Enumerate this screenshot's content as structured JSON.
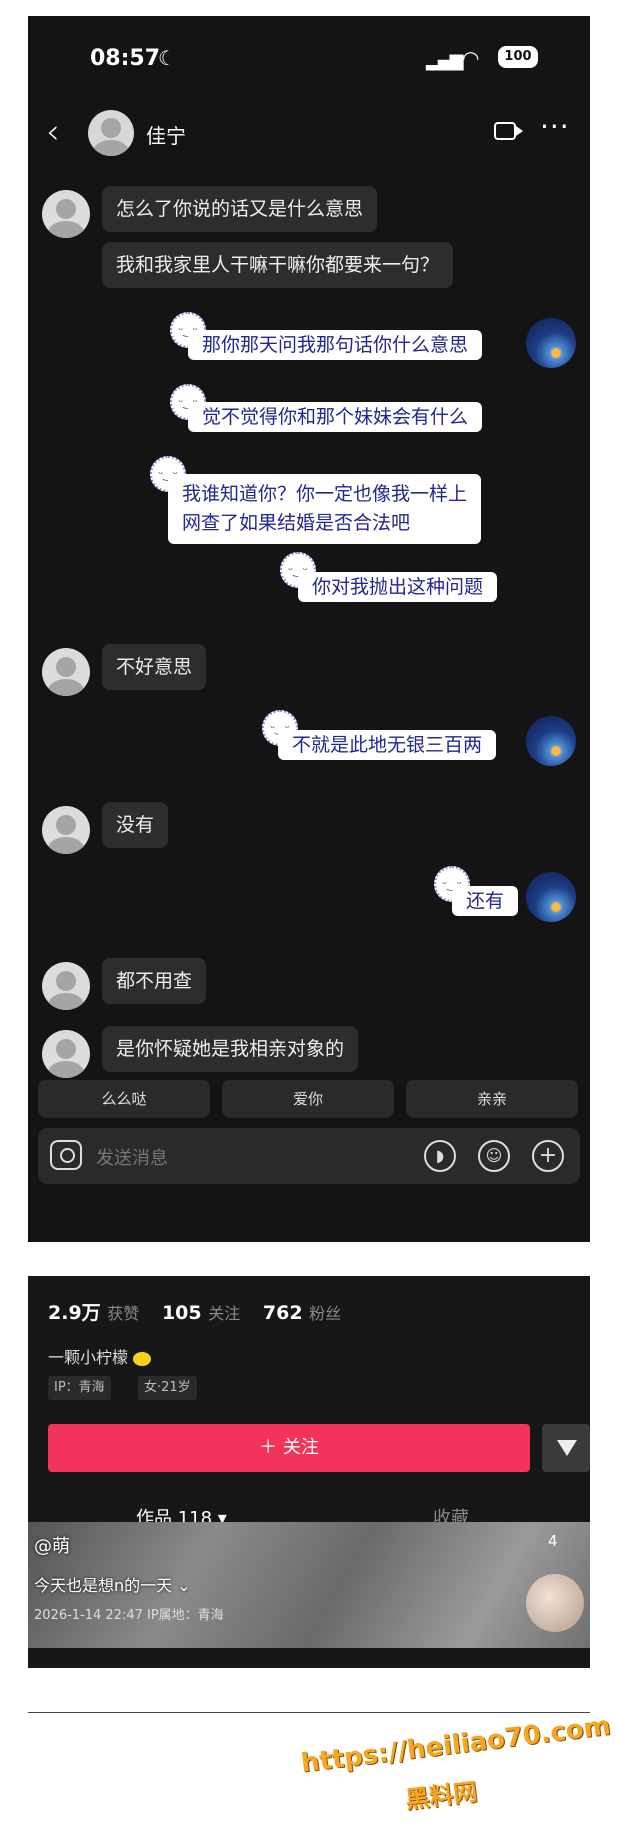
{
  "status_bar": {
    "time": "08:57",
    "battery": "100"
  },
  "header": {
    "contact_name": "佳宁"
  },
  "messages": [
    {
      "side": "left",
      "text": "怎么了你说的话又是什么意思"
    },
    {
      "side": "left",
      "text": "我和我家里人干嘛干嘛你都要来一句？"
    },
    {
      "side": "right",
      "text": "那你那天问我那句话你什么意思"
    },
    {
      "side": "right",
      "text": "觉不觉得你和那个妹妹会有什么"
    },
    {
      "side": "right",
      "text_line1": "我谁知道你？你一定也像我一样上",
      "text_line2": "网查了如果结婚是否合法吧"
    },
    {
      "side": "right",
      "text": "你对我抛出这种问题"
    },
    {
      "side": "left",
      "text": "不好意思"
    },
    {
      "side": "right",
      "text": "不就是此地无银三百两"
    },
    {
      "side": "left",
      "text": "没有"
    },
    {
      "side": "right",
      "text": "还有"
    },
    {
      "side": "left",
      "text": "都不用查"
    },
    {
      "side": "left",
      "text": "是你怀疑她是我相亲对象的"
    }
  ],
  "quick_replies": [
    "么么哒",
    "爱你",
    "亲亲"
  ],
  "input": {
    "placeholder": "发送消息"
  },
  "profile": {
    "likes": "2.9万",
    "likes_label": "获赞",
    "following": "105",
    "following_label": "关注",
    "followers": "762",
    "followers_label": "粉丝",
    "bio": "一颗小柠檬",
    "ip_tag": "IP：青海",
    "gender_age_tag": "女·21岁",
    "follow_button": "＋ 关注",
    "tab_works": "作品 118 ▾",
    "tab_favorites": "收藏"
  },
  "video": {
    "username": "@萌",
    "count": "4",
    "title": "今天也是想n的一天 ⌄",
    "meta": "2026-1-14 22:47  IP属地：青海"
  },
  "watermark": {
    "url": "https://heiliao70.com",
    "name": "黑料网"
  }
}
